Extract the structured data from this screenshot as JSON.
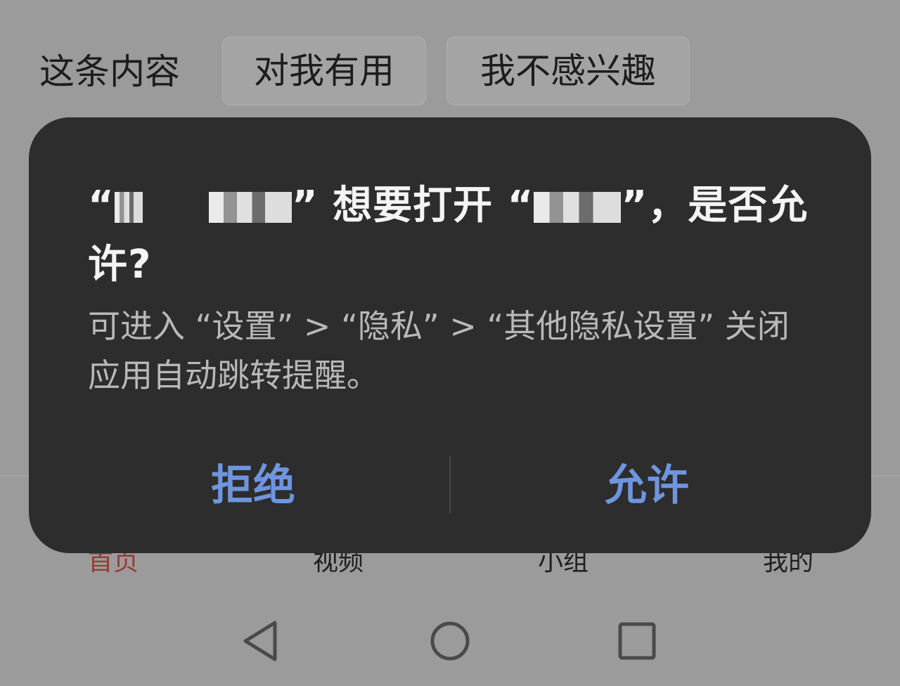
{
  "feedback": {
    "prompt": "这条内容",
    "useful_label": "对我有用",
    "not_interested_label": "我不感兴趣"
  },
  "dialog": {
    "title_open_quote": "“",
    "title_close_quote": "”",
    "title_middle": "想要打开",
    "title_end": "，是否允许?",
    "description": "可进入 “设置” > “隐私” > “其他隐私设置” 关闭应用自动跳转提醒。",
    "deny_label": "拒绝",
    "allow_label": "允许",
    "button_color": "#6f95df"
  },
  "bottom_nav": {
    "items": [
      {
        "label": "首页",
        "active": true,
        "color": "#9a3a34"
      },
      {
        "label": "视频",
        "active": false
      },
      {
        "label": "小组",
        "active": false
      },
      {
        "label": "我的",
        "active": false
      }
    ]
  },
  "system_nav": {
    "icons": [
      "back-triangle-icon",
      "home-circle-icon",
      "recents-square-icon"
    ]
  }
}
